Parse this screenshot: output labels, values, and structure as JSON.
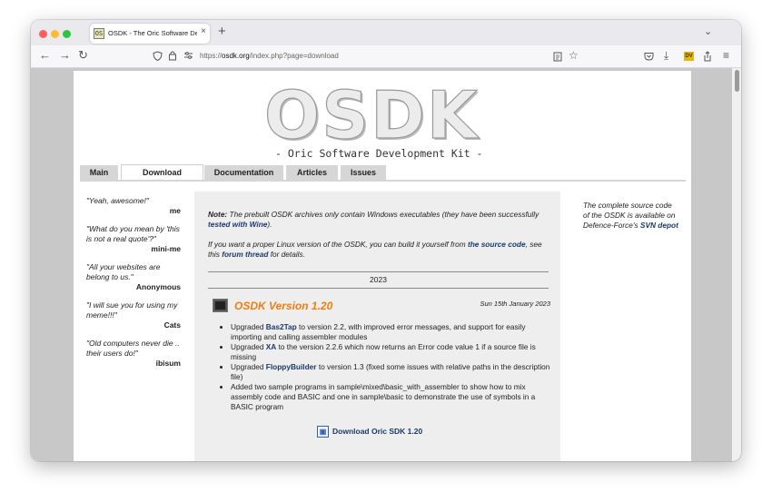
{
  "browser": {
    "tab_title": "OSDK - The Oric Software Devel",
    "tab_close": "×",
    "new_tab": "+",
    "tab_list": "⌄",
    "url_prefix": "https://",
    "url_domain": "osdk.org",
    "url_path": "/index.php?page=download",
    "favicon": "OS"
  },
  "site": {
    "logo": "OSDK",
    "subtitle": "- Oric Software Development Kit -"
  },
  "menu": [
    {
      "label": "Main",
      "active": false
    },
    {
      "label": "Download",
      "active": true
    },
    {
      "label": "Documentation",
      "active": false
    },
    {
      "label": "Articles",
      "active": false
    },
    {
      "label": "Issues",
      "active": false
    }
  ],
  "quotes": [
    {
      "text": "\"Yeah, awesome!\"",
      "author": "me"
    },
    {
      "text": "\"What do you mean by 'this is not a real quote'?\"",
      "author": "mini-me"
    },
    {
      "text": "\"All your websites are belong to us.\"",
      "author": "Anonymous"
    },
    {
      "text": "\"I will sue you for using my meme!!!\"",
      "author": "Cats"
    },
    {
      "text": "\"Old computers never die .. their users do!\"",
      "author": "ibisum"
    }
  ],
  "main": {
    "note_label": "Note:",
    "note_text": " The prebuilt OSDK archives only contain Windows executables (they have been successfully ",
    "note_link": "tested with Wine",
    "note_end": ").",
    "linux_text": "If you want a proper Linux version of the OSDK, you can build it yourself from ",
    "linux_link1": "the source code",
    "linux_mid": ", see this ",
    "linux_link2": "forum thread",
    "linux_end": " for details.",
    "year": "2023",
    "post": {
      "title": "OSDK Version 1.20",
      "date": "Sun 15th January 2023",
      "changes": [
        {
          "pre": "Upgraded ",
          "link": "Bas2Tap",
          "post": " to version 2.2, with improved error messages, and support for easily importing and calling assembler modules"
        },
        {
          "pre": "Upgraded ",
          "link": "XA",
          "post": " to the version 2.2.6 which now returns an Error code value 1 if a source file is missing"
        },
        {
          "pre": "Upgraded ",
          "link": "FloppyBuilder",
          "post": " to version 1.3 (fixed some issues with relative paths in the description file)"
        },
        {
          "pre": "Added two sample programs in sample\\mixed\\basic_with_assembler to show how to mix assembly code and BASIC and one in sample\\basic to demonstrate the use of symbols in a BASIC program",
          "link": "",
          "post": ""
        }
      ],
      "download": "Download Oric SDK 1.20"
    }
  },
  "sidebar_note": {
    "text": "The complete source code of the OSDK is available on Defence-Force's ",
    "link": "SVN depot"
  }
}
